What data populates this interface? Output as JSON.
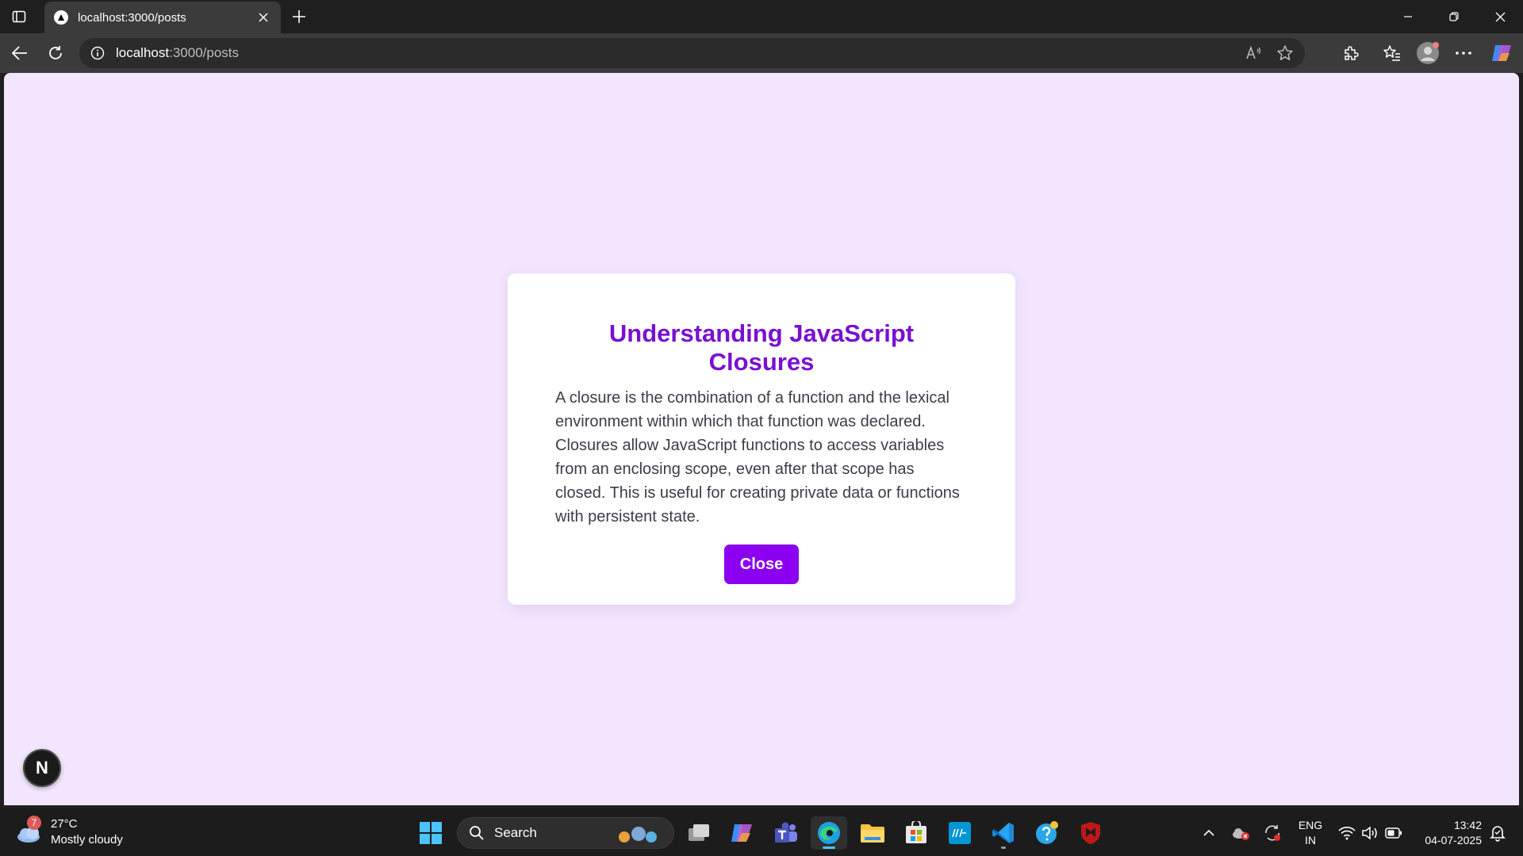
{
  "browser": {
    "tab_title": "localhost:3000/posts",
    "url_host": "localhost",
    "url_rest": ":3000/posts"
  },
  "modal": {
    "title": "Understanding JavaScript Closures",
    "body": "A closure is the combination of a function and the lexical environment within which that function was declared. Closures allow JavaScript functions to access variables from an enclosing scope, even after that scope has closed. This is useful for creating private data or functions with persistent state.",
    "close_label": "Close"
  },
  "dev_badge": "N",
  "taskbar": {
    "weather_badge": "7",
    "temperature": "27°C",
    "condition": "Mostly cloudy",
    "search_label": "Search",
    "lang_line1": "ENG",
    "lang_line2": "IN",
    "time": "13:42",
    "date": "04-07-2025"
  },
  "colors": {
    "page_bg": "#f3e5fd",
    "accent": "#8b00f0",
    "title": "#7a0fd0"
  }
}
